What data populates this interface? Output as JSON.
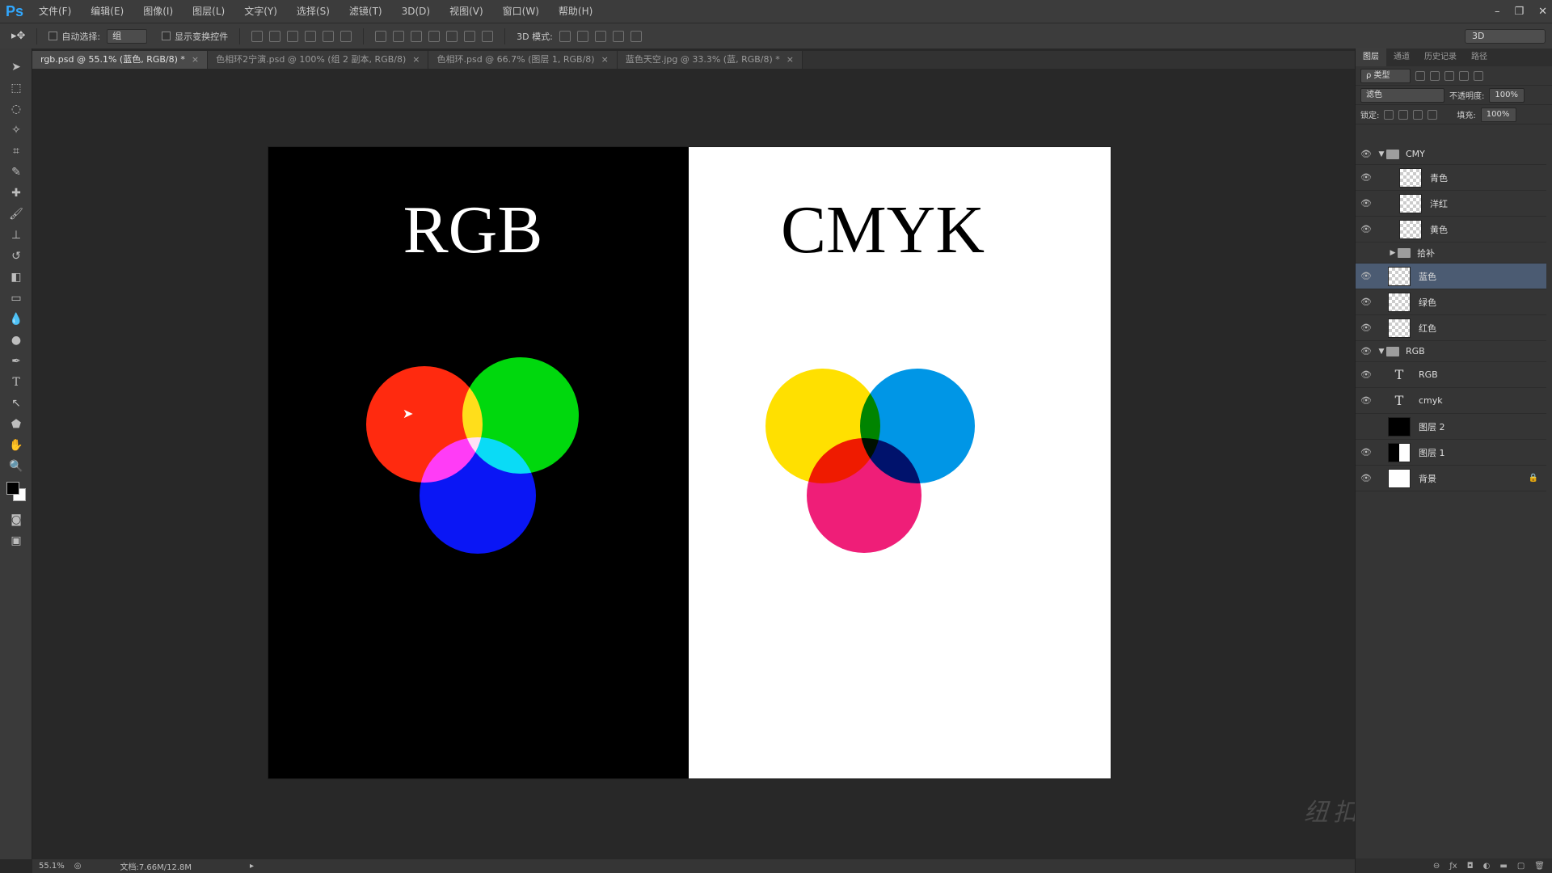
{
  "app": {
    "logo": "Ps",
    "menu": [
      "文件(F)",
      "编辑(E)",
      "图像(I)",
      "图层(L)",
      "文字(Y)",
      "选择(S)",
      "滤镜(T)",
      "3D(D)",
      "视图(V)",
      "窗口(W)",
      "帮助(H)"
    ],
    "window_controls": [
      "–",
      "❐",
      "✕"
    ]
  },
  "options": {
    "auto_select_label": "自动选择:",
    "auto_select_value": "组",
    "show_transform_label": "显示变换控件",
    "mode_3d_label": "3D 模式:",
    "workspace_value": "3D"
  },
  "tabs": [
    {
      "label": "rgb.psd @ 55.1% (蓝色, RGB/8) *",
      "active": true
    },
    {
      "label": "色相环2宁演.psd @ 100% (组 2 副本, RGB/8)",
      "active": false
    },
    {
      "label": "色相环.psd @ 66.7% (图层 1, RGB/8)",
      "active": false
    },
    {
      "label": "蓝色天空.jpg @ 33.3% (蓝, RGB/8) *",
      "active": false
    }
  ],
  "tab_close": "×",
  "canvas": {
    "left_title": "RGB",
    "right_title": "CMYK",
    "colors": {
      "rgb_bg": "#000000",
      "cmyk_bg": "#ffffff",
      "red": "#ff2a0f",
      "green": "#00d80d",
      "blue": "#0a16f5",
      "yellow": "#ffe000",
      "cyan": "#0096e6",
      "magenta": "#ef1e78"
    }
  },
  "watermark": "纽扣摄影后期教程",
  "status": {
    "zoom": "55.1%",
    "doc": "文档:7.66M/12.8M"
  },
  "panel": {
    "tabs": [
      "图层",
      "通道",
      "历史记录",
      "路径"
    ],
    "kind_label": "ρ 类型",
    "blend_mode": "滤色",
    "opacity_label": "不透明度:",
    "opacity_value": "100%",
    "lock_label": "锁定:",
    "fill_label": "填充:",
    "fill_value": "100%",
    "layers": [
      {
        "name": "CMY",
        "type": "group",
        "expanded": true,
        "visible": true,
        "depth": 0
      },
      {
        "name": "青色",
        "type": "pixel",
        "visible": true,
        "depth": 2
      },
      {
        "name": "洋红",
        "type": "pixel",
        "visible": true,
        "depth": 2
      },
      {
        "name": "黄色",
        "type": "pixel",
        "visible": true,
        "depth": 2
      },
      {
        "name": "拾补",
        "type": "group",
        "expanded": false,
        "visible": false,
        "depth": 1
      },
      {
        "name": "蓝色",
        "type": "pixel",
        "visible": true,
        "selected": true,
        "depth": 1
      },
      {
        "name": "绿色",
        "type": "pixel",
        "visible": true,
        "depth": 1
      },
      {
        "name": "红色",
        "type": "pixel",
        "visible": true,
        "depth": 1
      },
      {
        "name": "RGB",
        "type": "group",
        "expanded": true,
        "visible": true,
        "depth": 0
      },
      {
        "name": "RGB",
        "type": "text",
        "visible": true,
        "depth": 1
      },
      {
        "name": "cmyk",
        "type": "text",
        "visible": true,
        "depth": 1
      },
      {
        "name": "图层 2",
        "type": "fill-black",
        "visible": false,
        "depth": 1
      },
      {
        "name": "图层 1",
        "type": "fill-split",
        "visible": true,
        "depth": 1
      },
      {
        "name": "背景",
        "type": "fill-white",
        "visible": true,
        "locked": true,
        "depth": 1
      }
    ]
  }
}
